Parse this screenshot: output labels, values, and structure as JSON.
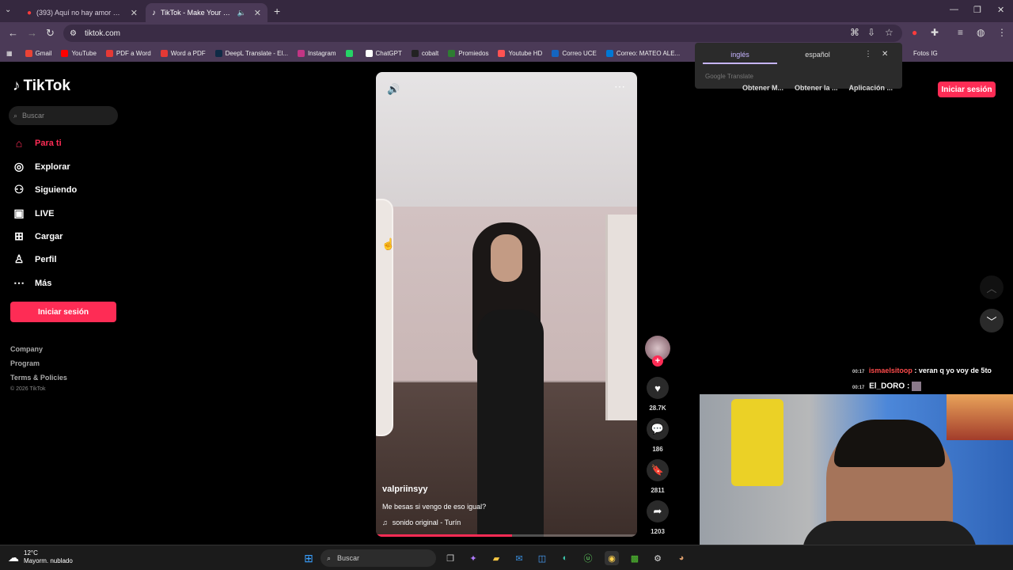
{
  "browser": {
    "tabs": [
      {
        "title": "(393) Aquí no hay amor 💔 - Y",
        "icon": "youtube-icon"
      },
      {
        "title": "TikTok - Make Your Day",
        "icon": "tiktok-icon"
      }
    ],
    "url": "tiktok.com",
    "bookmarks": [
      {
        "label": "Gmail",
        "color": "#ea4335"
      },
      {
        "label": "YouTube",
        "color": "#ff0000"
      },
      {
        "label": "PDF a Word",
        "color": "#e53935"
      },
      {
        "label": "Word a PDF",
        "color": "#e53935"
      },
      {
        "label": "DeepL Translate - El...",
        "color": "#0f2b46"
      },
      {
        "label": "Instagram",
        "color": "#c13584"
      },
      {
        "label": "",
        "color": "#25d366"
      },
      {
        "label": "ChatGPT",
        "color": "#ffffff"
      },
      {
        "label": "cobalt",
        "color": "#222222"
      },
      {
        "label": "Promiedos",
        "color": "#2e7d32"
      },
      {
        "label": "Youtube HD",
        "color": "#ff5252"
      },
      {
        "label": "Correo UCE",
        "color": "#1565c0"
      },
      {
        "label": "Correo: MATEO ALE...",
        "color": "#0078d4"
      }
    ],
    "bookmark_end": "Fotos IG"
  },
  "translate_popup": {
    "lang_from": "inglés",
    "lang_to": "español",
    "brand": "Google Translate"
  },
  "tiktok": {
    "logo": "TikTok",
    "search_placeholder": "Buscar",
    "nav": [
      {
        "label": "Para ti",
        "icon": "home-icon",
        "active": true
      },
      {
        "label": "Explorar",
        "icon": "compass-icon"
      },
      {
        "label": "Siguiendo",
        "icon": "following-icon"
      },
      {
        "label": "LIVE",
        "icon": "live-icon"
      },
      {
        "label": "Cargar",
        "icon": "upload-icon"
      },
      {
        "label": "Perfil",
        "icon": "profile-icon"
      },
      {
        "label": "Más",
        "icon": "more-icon"
      }
    ],
    "login_label": "Iniciar sesión",
    "footer": [
      "Company",
      "Program",
      "Terms & Policies"
    ],
    "copyright": "© 2026 TikTok",
    "header_links": [
      "Obtener M...",
      "Obtener la ...",
      "Aplicación ..."
    ],
    "video": {
      "username": "valpriinsyy",
      "caption": "Me besas si vengo de eso igual?",
      "music": "sonido original - Turín",
      "progress": 0.52,
      "likes": "28.7K",
      "comments": "186",
      "saves": "2811",
      "shares": "1203"
    }
  },
  "stream": {
    "chat": [
      {
        "time": "00:17",
        "user": "ismaelsitoop",
        "user_color": "#ff4b4b",
        "text": ": veran q yo voy de 5to"
      },
      {
        "time": "00:17",
        "user": "El_DORO",
        "user_color": "#ffffff",
        "text": ":"
      }
    ]
  },
  "taskbar": {
    "temp": "12°C",
    "weather": "Mayorm. nublado",
    "search": "Buscar"
  }
}
